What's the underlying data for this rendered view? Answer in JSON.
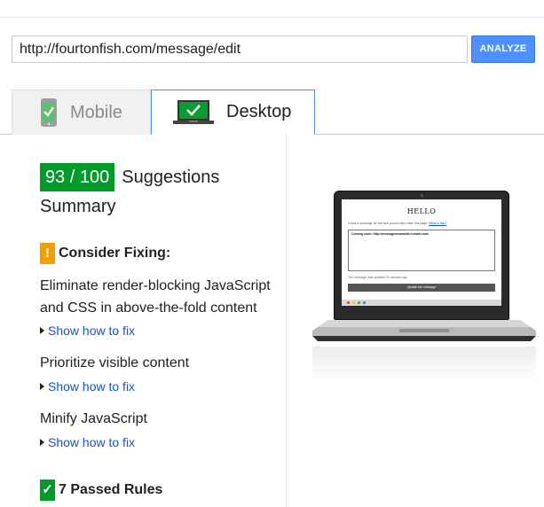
{
  "url_bar": {
    "value": "http://fourtonfish.com/message/edit",
    "analyze_label": "ANALYZE"
  },
  "tabs": [
    {
      "label": "Mobile",
      "icon": "mobile-phone-check-icon",
      "active": false
    },
    {
      "label": "Desktop",
      "icon": "desktop-monitor-check-icon",
      "active": true
    }
  ],
  "summary": {
    "score": "93 / 100",
    "score_suffix": "Suggestions",
    "summary_label": "Summary"
  },
  "consider_fixing": {
    "badge": "!",
    "heading": "Consider Fixing:",
    "rules": [
      {
        "title": "Eliminate render-blocking JavaScript and CSS in above-the-fold content",
        "link": "Show how to fix"
      },
      {
        "title": "Prioritize visible content",
        "link": "Show how to fix"
      },
      {
        "title": "Minify JavaScript",
        "link": "Show how to fix"
      }
    ]
  },
  "passed": {
    "badge": "✓",
    "heading": "7 Passed Rules"
  },
  "preview": {
    "title": "HELLO",
    "intro": "Leave a message for the next person who visits this page.",
    "intro_link": "What is this?",
    "message": "Coming soon: http://messageonwebsite.tumblr.com/",
    "updated": "The message was updated 26 minutes ago.",
    "button": "Update the message"
  },
  "colors": {
    "accent": "#4d90fe",
    "good": "#009a2d",
    "warning": "#f29f00",
    "link": "#1155cc"
  }
}
